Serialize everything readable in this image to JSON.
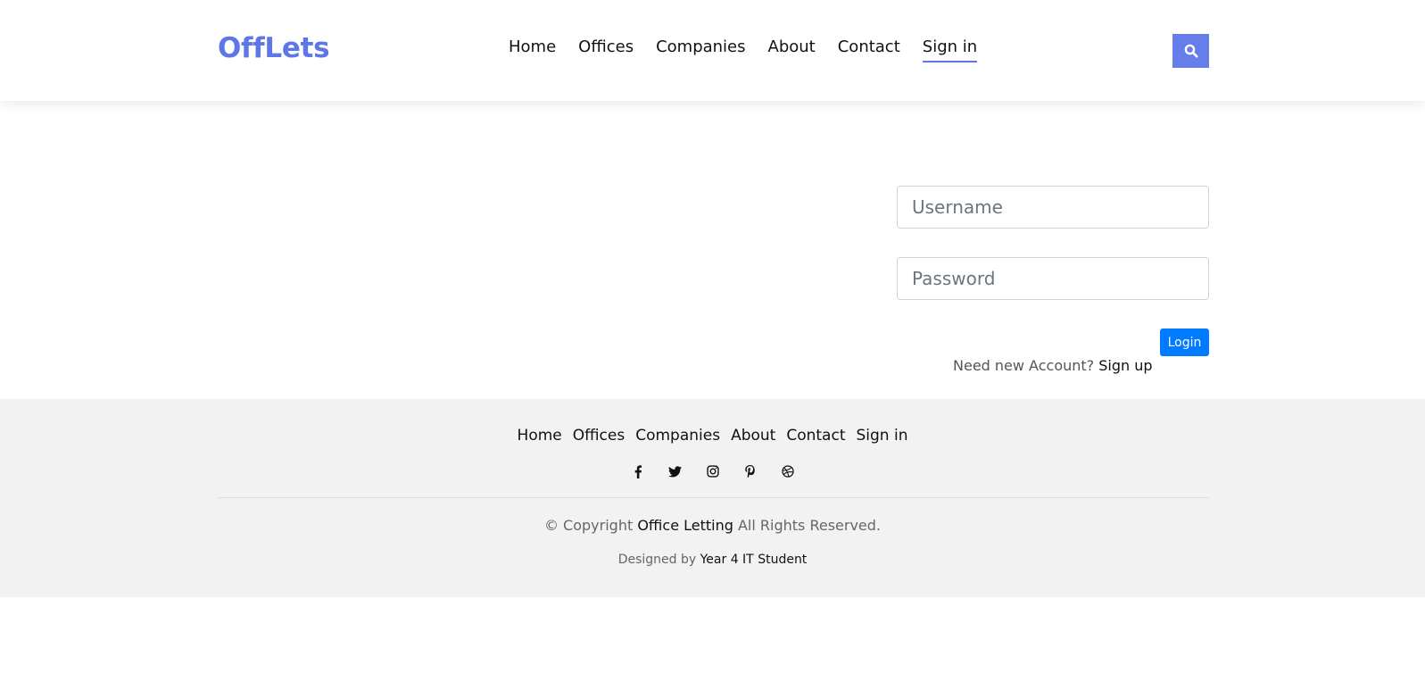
{
  "brand": {
    "logo_text": "OffLets",
    "accent_color": "#5e77e6"
  },
  "nav": {
    "items": [
      {
        "label": "Home"
      },
      {
        "label": "Offices"
      },
      {
        "label": "Companies"
      },
      {
        "label": "About"
      },
      {
        "label": "Contact"
      },
      {
        "label": "Sign in",
        "active": true
      }
    ],
    "search_icon": "search-icon"
  },
  "login": {
    "username_placeholder": "Username",
    "password_placeholder": "Password",
    "login_label": "Login",
    "signup_prompt": "Need new Account?",
    "signup_link": "Sign up",
    "button_color": "#007bff"
  },
  "footer": {
    "links": [
      "Home",
      "Offices",
      "Companies",
      "About",
      "Contact",
      "Sign in"
    ],
    "social_icons": [
      "facebook-icon",
      "twitter-icon",
      "instagram-icon",
      "pinterest-icon",
      "dribbble-icon"
    ],
    "copyright_prefix": "© Copyright",
    "copyright_name": "Office Letting",
    "copyright_suffix": "All Rights Reserved.",
    "designed_prefix": "Designed by",
    "designed_by": "Year 4 IT Student",
    "background_color": "#f2f2f2"
  }
}
